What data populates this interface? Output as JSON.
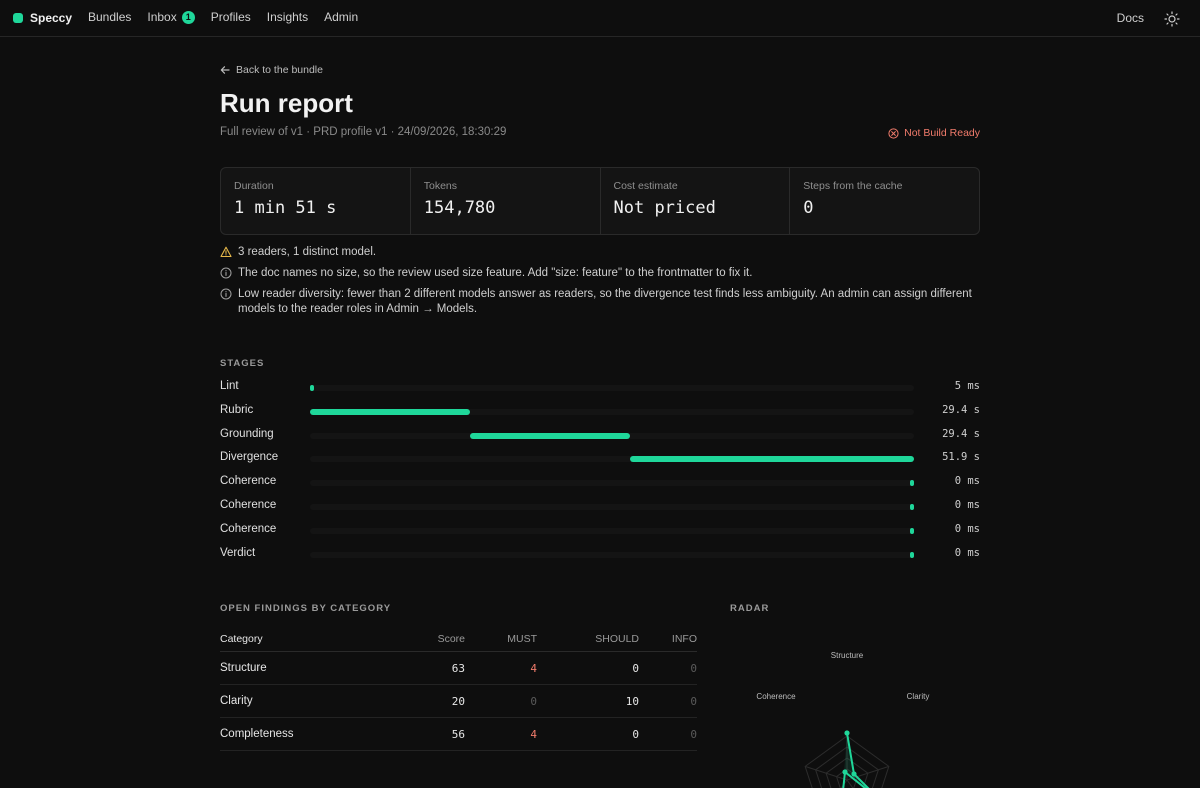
{
  "nav": {
    "brand": "Speccy",
    "items": [
      {
        "label": "Bundles"
      },
      {
        "label": "Inbox",
        "badge": "1"
      },
      {
        "label": "Profiles"
      },
      {
        "label": "Insights"
      },
      {
        "label": "Admin"
      }
    ],
    "docs": "Docs"
  },
  "page": {
    "back": "Back to the bundle",
    "title": "Run report",
    "subtitle": "Full review of v1 · PRD profile v1 · 24/09/2026, 18:30:29",
    "status": "Not Build Ready",
    "status_color": "#f07b6b"
  },
  "metrics": [
    {
      "label": "Duration",
      "value": "1 min 51 s"
    },
    {
      "label": "Tokens",
      "value": "154,780"
    },
    {
      "label": "Cost estimate",
      "value": "Not priced"
    },
    {
      "label": "Steps from the cache",
      "value": "0"
    }
  ],
  "notes": [
    {
      "icon": "warning-icon",
      "text": "3 readers, 1 distinct model."
    },
    {
      "icon": "info-icon",
      "text": "The doc names no size, so the review used size feature. Add \"size: feature\" to the frontmatter to fix it."
    },
    {
      "icon": "info-icon",
      "text": "Low reader diversity: fewer than 2 different models answer as readers, so the divergence test finds less ambiguity. An admin can assign different models to the reader roles in Admin → Models."
    }
  ],
  "stages_label": "STAGES",
  "stages": [
    {
      "name": "Lint",
      "time": "5 ms",
      "start": 0.0,
      "end": 0.004
    },
    {
      "name": "Rubric",
      "time": "29.4 s",
      "start": 0.0,
      "end": 0.265
    },
    {
      "name": "Grounding",
      "time": "29.4 s",
      "start": 0.265,
      "end": 0.53
    },
    {
      "name": "Divergence",
      "time": "51.9 s",
      "start": 0.53,
      "end": 1.0
    },
    {
      "name": "Coherence",
      "time": "0 ms",
      "start": 1.0,
      "end": 1.0
    },
    {
      "name": "Coherence",
      "time": "0 ms",
      "start": 1.0,
      "end": 1.0
    },
    {
      "name": "Coherence",
      "time": "0 ms",
      "start": 1.0,
      "end": 1.0
    },
    {
      "name": "Verdict",
      "time": "0 ms",
      "start": 1.0,
      "end": 1.0
    }
  ],
  "findings_label": "OPEN FINDINGS BY CATEGORY",
  "findings": {
    "headers": {
      "category": "Category",
      "score": "Score",
      "must": "MUST",
      "should": "SHOULD",
      "info": "INFO"
    },
    "rows": [
      {
        "category": "Structure",
        "score": "63",
        "must": "4",
        "should": "0",
        "info": "0"
      },
      {
        "category": "Clarity",
        "score": "20",
        "must": "0",
        "should": "10",
        "info": "0"
      },
      {
        "category": "Completeness",
        "score": "56",
        "must": "4",
        "should": "0",
        "info": "0"
      }
    ]
  },
  "radar_label": "RADAR",
  "radar": {
    "axes": [
      "Structure",
      "Clarity",
      "Coherence"
    ],
    "accent": "#1fd79a"
  }
}
